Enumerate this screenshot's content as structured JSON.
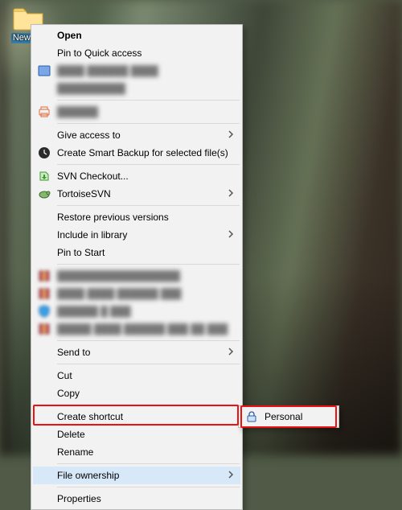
{
  "desktop": {
    "icon_label": "New f..."
  },
  "menu": {
    "open": "Open",
    "pin_quick": "Pin to Quick access",
    "obscured1": "████ ██████ ████",
    "obscured2": "██████████",
    "obscured3": "██████",
    "give_access": "Give access to",
    "smart_backup": "Create Smart Backup for selected file(s)",
    "svn_checkout": "SVN Checkout...",
    "tortoise": "TortoiseSVN",
    "restore_prev": "Restore previous versions",
    "include_lib": "Include in library",
    "pin_start": "Pin to Start",
    "obscured4": "██████████████████",
    "obscured5": "████  ████ ██████ ███",
    "obscured6": "██████ █ ███",
    "obscured7": "█████ ████ ██████ ███ ██ ███",
    "send_to": "Send to",
    "cut": "Cut",
    "copy": "Copy",
    "create_shortcut": "Create shortcut",
    "delete": "Delete",
    "rename": "Rename",
    "file_ownership": "File ownership",
    "properties": "Properties"
  },
  "submenu": {
    "personal": "Personal"
  }
}
